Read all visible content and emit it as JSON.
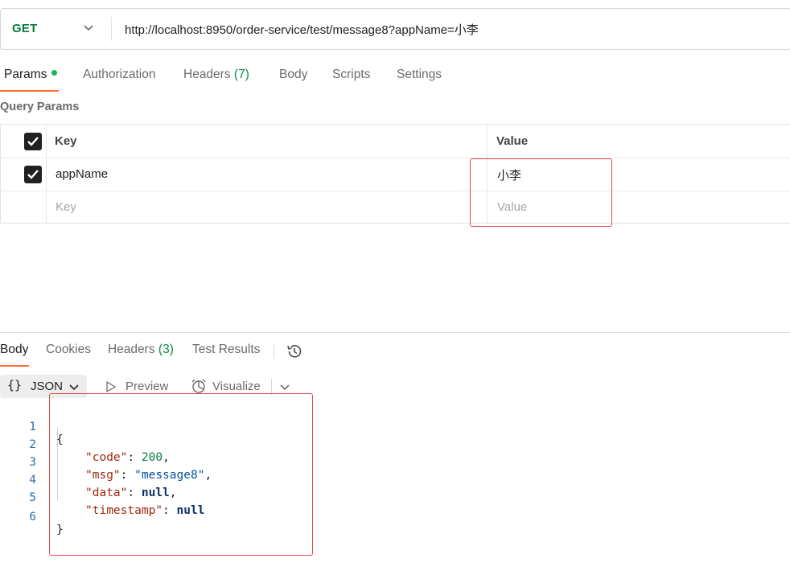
{
  "request": {
    "method": "GET",
    "url": "http://localhost:8950/order-service/test/message8?appName=小李"
  },
  "request_tabs": [
    {
      "label": "Params",
      "active": true
    },
    {
      "label": "Authorization"
    },
    {
      "label": "Headers",
      "count": "(7)"
    },
    {
      "label": "Body"
    },
    {
      "label": "Scripts"
    },
    {
      "label": "Settings"
    }
  ],
  "query_params": {
    "title": "Query Params",
    "header": {
      "key": "Key",
      "value": "Value"
    },
    "rows": [
      {
        "key": "appName",
        "value": "小李",
        "checked": true
      }
    ],
    "placeholder": {
      "key": "Key",
      "value": "Value"
    }
  },
  "response_tabs": [
    {
      "label": "Body",
      "active": true
    },
    {
      "label": "Cookies"
    },
    {
      "label": "Headers",
      "count": "(3)"
    },
    {
      "label": "Test Results"
    }
  ],
  "format_bar": {
    "braces": "{}",
    "format": "JSON",
    "preview": "Preview",
    "visualize": "Visualize"
  },
  "response_body": {
    "line_numbers": [
      "1",
      "2",
      "3",
      "4",
      "5",
      "6"
    ],
    "open_brace": "{",
    "close_brace": "}",
    "fields": [
      {
        "key": "\"code\"",
        "value": "200",
        "comma": ","
      },
      {
        "key": "\"msg\"",
        "value": "\"message8\"",
        "comma": ","
      },
      {
        "key": "\"data\"",
        "value": "null",
        "comma": ","
      },
      {
        "key": "\"timestamp\"",
        "value": "null",
        "comma": ""
      }
    ]
  },
  "colors": {
    "accent": "#ff6c37",
    "method_get": "#0b7a3e",
    "highlight_box": "#e64a4a",
    "active_dot": "#0cbb52"
  }
}
